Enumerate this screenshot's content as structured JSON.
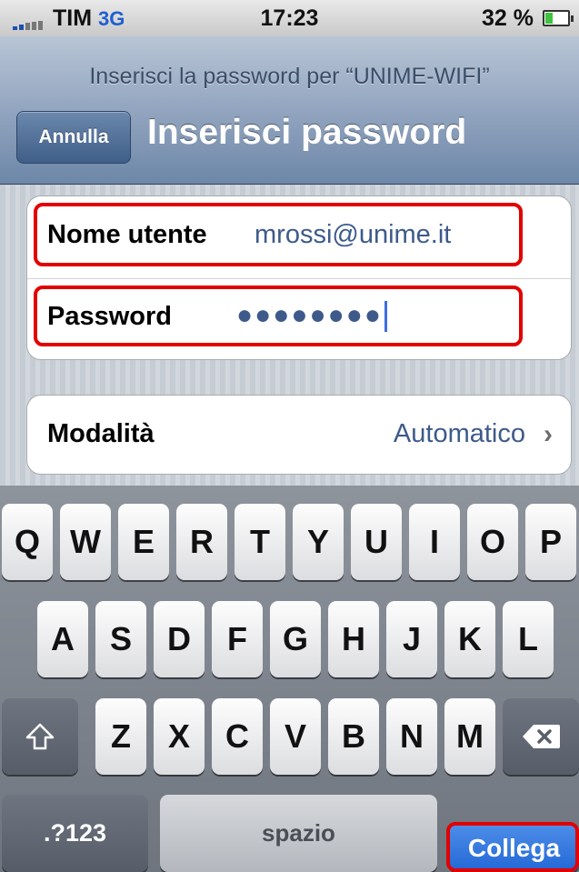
{
  "status_bar": {
    "carrier": "TIM",
    "network": "3G",
    "time": "17:23",
    "battery_percent": "32 %",
    "battery_level": 0.32
  },
  "navbar": {
    "prompt": "Inserisci la password per “UNIME-WIFI”",
    "cancel_label": "Annulla",
    "title": "Inserisci password"
  },
  "form": {
    "username_label": "Nome utente",
    "username_value": "mrossi@unime.it",
    "password_label": "Password",
    "password_value": "●●●●●●●●",
    "mode_label": "Modalità",
    "mode_value": "Automatico"
  },
  "keyboard": {
    "row1": [
      "Q",
      "W",
      "E",
      "R",
      "T",
      "Y",
      "U",
      "I",
      "O",
      "P"
    ],
    "row2": [
      "A",
      "S",
      "D",
      "F",
      "G",
      "H",
      "J",
      "K",
      "L"
    ],
    "row3": [
      "Z",
      "X",
      "C",
      "V",
      "B",
      "N",
      "M"
    ],
    "numbers_label": ".?123",
    "space_label": "spazio",
    "go_label": "Collega"
  },
  "icons": {
    "shift": "shift-icon",
    "backspace": "backspace-icon",
    "chevron": "chevron-right-icon"
  },
  "colors": {
    "highlight": "#e20000",
    "accent_blue": "#2167d6",
    "value_text": "#3d5a8b"
  }
}
